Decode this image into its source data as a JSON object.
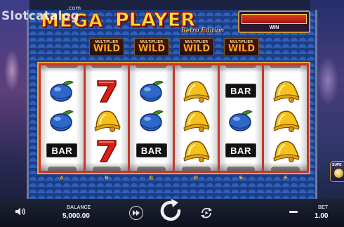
{
  "watermark": {
    "text": "Slotcatalog",
    "suffix": ".com"
  },
  "logo": {
    "word1": "MEGA",
    "word2": "PLAYER",
    "tagline": "Retro Edition"
  },
  "win_box": {
    "label": "WIN"
  },
  "multiplier_wilds": [
    {
      "top": "MULTIPLIER",
      "bottom": "WILD"
    },
    {
      "top": "MULTIPLIER",
      "bottom": "WILD"
    },
    {
      "top": "MULTIPLIER",
      "bottom": "WILD"
    },
    {
      "top": "MULTIPLIER",
      "bottom": "WILD"
    }
  ],
  "reels": [
    {
      "letter": "A",
      "symbols": [
        "blueberry",
        "blueberry",
        "bar"
      ]
    },
    {
      "letter": "B",
      "symbols": [
        "seven",
        "bell",
        "seven"
      ]
    },
    {
      "letter": "C",
      "symbols": [
        "blueberry",
        "blueberry",
        "bar"
      ]
    },
    {
      "letter": "D",
      "symbols": [
        "bell",
        "bell",
        "bell"
      ]
    },
    {
      "letter": "E",
      "symbols": [
        "bar",
        "blueberry",
        "bar"
      ]
    },
    {
      "letter": "F",
      "symbols": [
        "bell",
        "bell",
        "bell"
      ]
    }
  ],
  "bar_text": "BAR",
  "super_bet": {
    "label": "SUPE"
  },
  "balance": {
    "label": "BALANCE",
    "value": "5,000.00"
  },
  "bet": {
    "label": "BET",
    "value": "1.00"
  },
  "colors": {
    "reel_frame": "#c7362a",
    "gold": "#ffc531",
    "panel_blue": "#1d3d83"
  }
}
